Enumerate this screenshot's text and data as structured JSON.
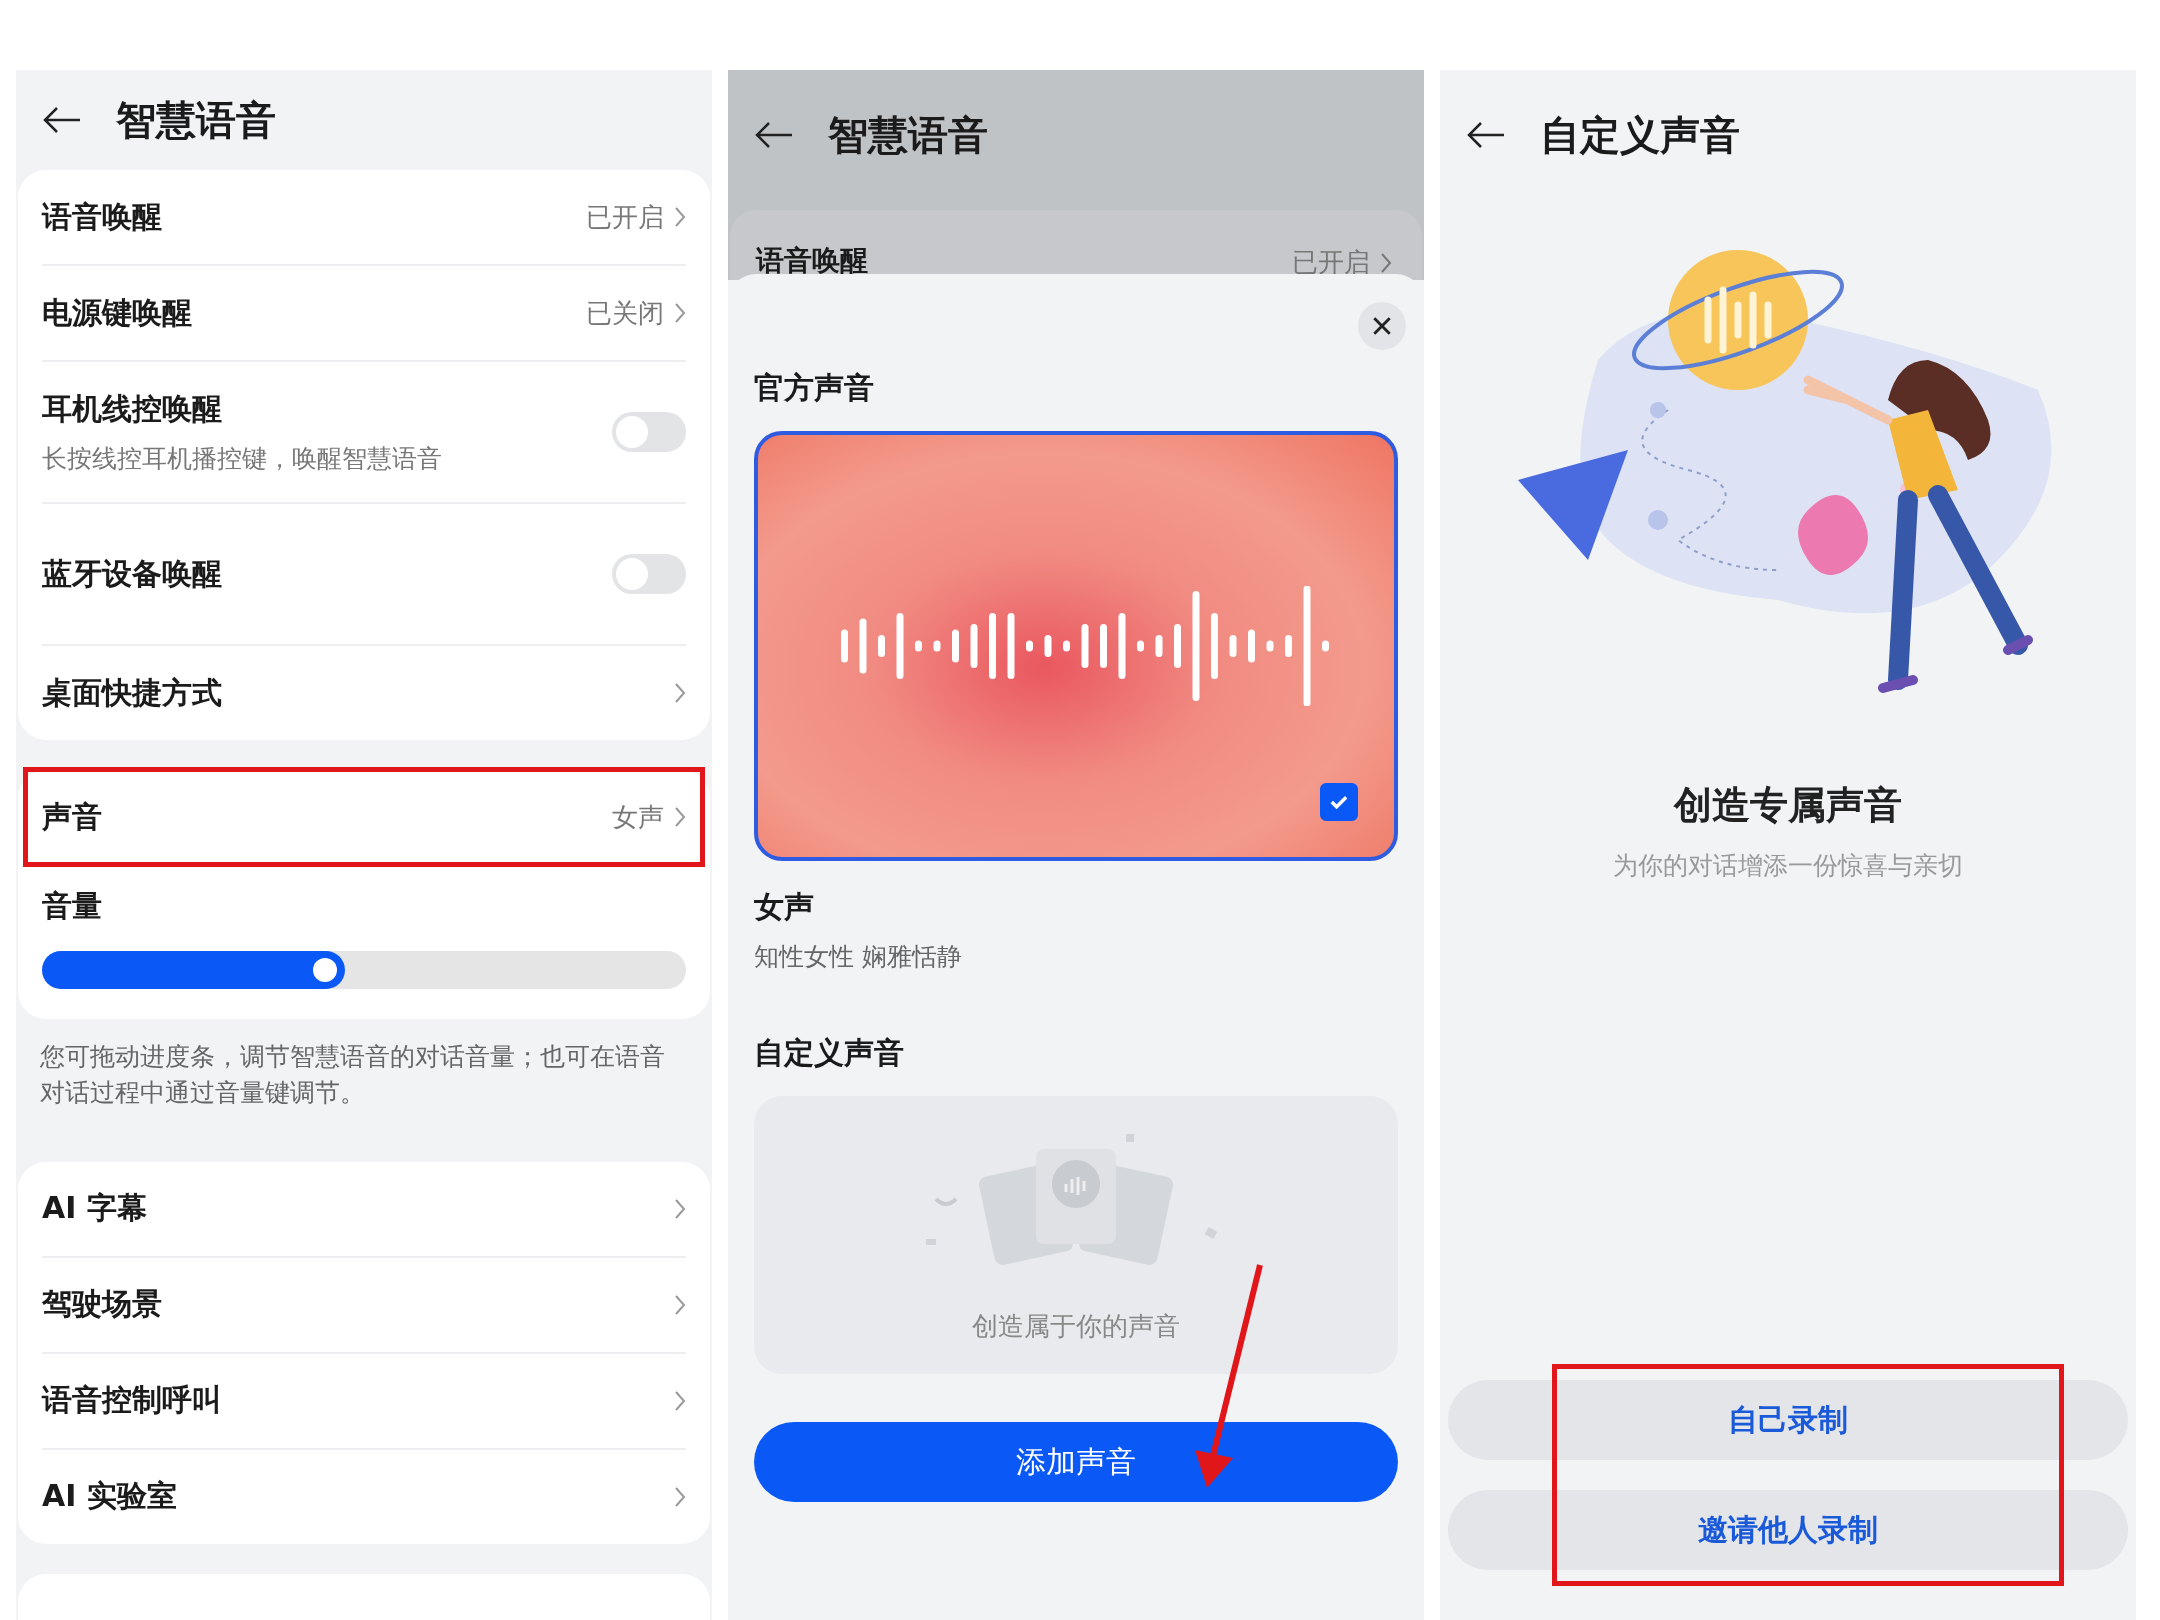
{
  "settings_screen": {
    "title": "智慧语音",
    "groups": [
      {
        "items": [
          {
            "kind": "link",
            "label": "语音唤醒",
            "value": "已开启"
          },
          {
            "kind": "link",
            "label": "电源键唤醒",
            "value": "已关闭"
          },
          {
            "kind": "toggle",
            "label": "耳机线控唤醒",
            "description": "长按线控耳机播控键，唤醒智慧语音",
            "on": false
          },
          {
            "kind": "toggle",
            "label": "蓝牙设备唤醒",
            "on": false
          },
          {
            "kind": "link",
            "label": "桌面快捷方式"
          }
        ]
      },
      {
        "items": [
          {
            "kind": "link",
            "label": "声音",
            "value": "女声",
            "highlighted": true
          },
          {
            "kind": "slider",
            "label": "音量",
            "level": 0.47
          }
        ],
        "note": "您可拖动进度条，调节智慧语音的对话音量；也可在语音对话过程中通过音量键调节。"
      },
      {
        "items": [
          {
            "kind": "link",
            "label": "AI 字幕"
          },
          {
            "kind": "link",
            "label": "驾驶场景"
          },
          {
            "kind": "link",
            "label": "语音控制呼叫"
          },
          {
            "kind": "link",
            "label": "AI 实验室"
          }
        ]
      }
    ]
  },
  "voice_sheet": {
    "background_title": "智慧语音",
    "background_row": {
      "label": "语音唤醒",
      "value": "已开启"
    },
    "official_title": "官方声音",
    "voices": [
      {
        "name": "女声",
        "description": "知性女性 娴雅恬静",
        "selected": true,
        "checked": true
      }
    ],
    "custom_title": "自定义声音",
    "empty_text": "创造属于你的声音",
    "add_button": "添加声音"
  },
  "custom_voice_screen": {
    "title": "自定义声音",
    "heading": "创造专属声音",
    "subtitle": "为你的对话增添一份惊喜与亲切",
    "buttons_highlighted": true,
    "buttons": [
      "自己录制",
      "邀请他人录制"
    ]
  }
}
